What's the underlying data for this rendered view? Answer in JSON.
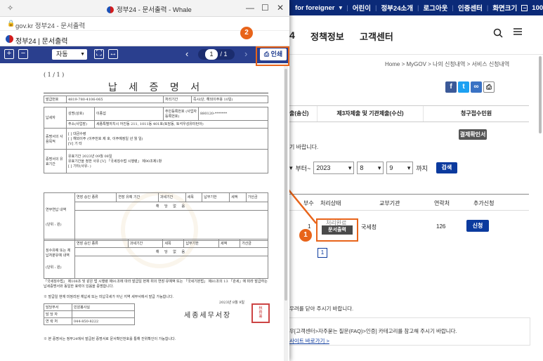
{
  "site": {
    "topbar": {
      "links": [
        "for foreigner",
        "어린이",
        "정부24소개",
        "로그아웃",
        "인증센터",
        "화면크기",
        "100%"
      ],
      "chevron": "chevron-down-icon"
    },
    "nav": {
      "digit": "4",
      "policy": "정책정보",
      "support": "고객센터"
    },
    "breadcrumb": "Home > MyGOV > 나의 신청내역 > 서비스 신청내역",
    "tabs": [
      "출(송신)",
      "제3자제출 및 기관제출(수신)",
      "청구접수민원"
    ],
    "settlement_button": "결제확인서",
    "hint_text": "기 바랍니다.",
    "date_range": {
      "from_label": "부터~",
      "year": "2023",
      "month": "8",
      "day": "9",
      "to_label": "까지",
      "search_button": "검색"
    },
    "table": {
      "headers": [
        "부수",
        "처리상태",
        "교부기관",
        "연락처",
        "추가신청"
      ],
      "row": {
        "count": "1",
        "status": "처리완료",
        "print_button": "문서출력",
        "agency": "국세청",
        "phone": "126",
        "apply_button": "신청"
      }
    },
    "pagination": "1",
    "footer_notes": [
      "우려를 닫아 주시기 바랍니다.",
      "우[고객센터>자주묻는 질문(FAQ)>인증] 카테고리를 참고해 주시기 바랍니다.",
      "사이트 바로가기 >"
    ]
  },
  "popup": {
    "window_title": "정부24 - 문서출력 - Whale",
    "url": "gov.kr  정부24 - 문서출력",
    "header_title": "정부24 | 문서출력",
    "toolbar": {
      "zoom_mode": "자동",
      "page_current": "1",
      "page_total": "/ 1",
      "print_label": "인쇄"
    }
  },
  "annotations": {
    "badge_1": "1",
    "badge_2": "2"
  },
  "document": {
    "page_no": "( 1 / 1 )",
    "title": "납 세 증 명 서",
    "issue_no_label": "발급번호",
    "issue_no": "4819-780-4106-065",
    "processing_label": "처리기간",
    "processing_value": "즉시(단, 해외이주용 10일)",
    "taxpayer_label": "납세자",
    "name_label": "성명(상호)",
    "name": "이종섭",
    "id_label": "주민등록번호 (사업자등록번호)",
    "id_value": "880120-*******",
    "addr_label": "주소(사업장)",
    "addr_value": "세종특별자치시 어진동 211, 1011동 401호(토담동, 토석우성유터턴아)",
    "purpose_label": "증명서의 사용목적",
    "purpose_lines": [
      "[ ] 대금수령",
      "[ ] 해외이주  (이주번호 제             호, 이주예정일        년   월   일)",
      "[V] 기     타"
    ],
    "valid_label": "증명서의 유효기간",
    "valid_lines": [
      "유효기간   2023년 09월 08일",
      "유효기간을 정한 사유  [V] 「국세징수법 시행령」 제90조제1항",
      "[ ] 기타(사유:                    )"
    ],
    "unpaid_label": "연부연납 내역",
    "deferred_label": "징수유예 또는 체납처분유예 내역",
    "unit_label": "(단위 : 원)",
    "col_headers": [
      "연장 승인 종류",
      "연장 유예 기간",
      "과세기간",
      "세목",
      "납부기한",
      "세액",
      "가산금"
    ],
    "na": "해  당  없  음",
    "body_note": "「국세징수법」 제108조 및 같은 법 시행령 제91조에 따라 발급일 현재 위의 연장·유예액 또는 「국세기본법」 제81조의 13 「관세」에 따라 발급하는 납세증명서와 동일한 효력이 있음을 증명합니다.",
    "issue_note": "※ 발급일 현재 미정리된 체납세 또는 미납국세가 아닌 지역 세무서에서 발급 가능합니다.",
    "date": "2023년 8월 9일",
    "office": "세종세무서장",
    "staff_label": "담당부서",
    "staff_value": "민원봉사실",
    "contact_label": "연 락 처",
    "contact_value": "044-850-8222",
    "footer": "※ 본 증명서는 정부24에서 발급된 증명서로 문서확인번호를 통해 진위확인이 가능합니다."
  }
}
